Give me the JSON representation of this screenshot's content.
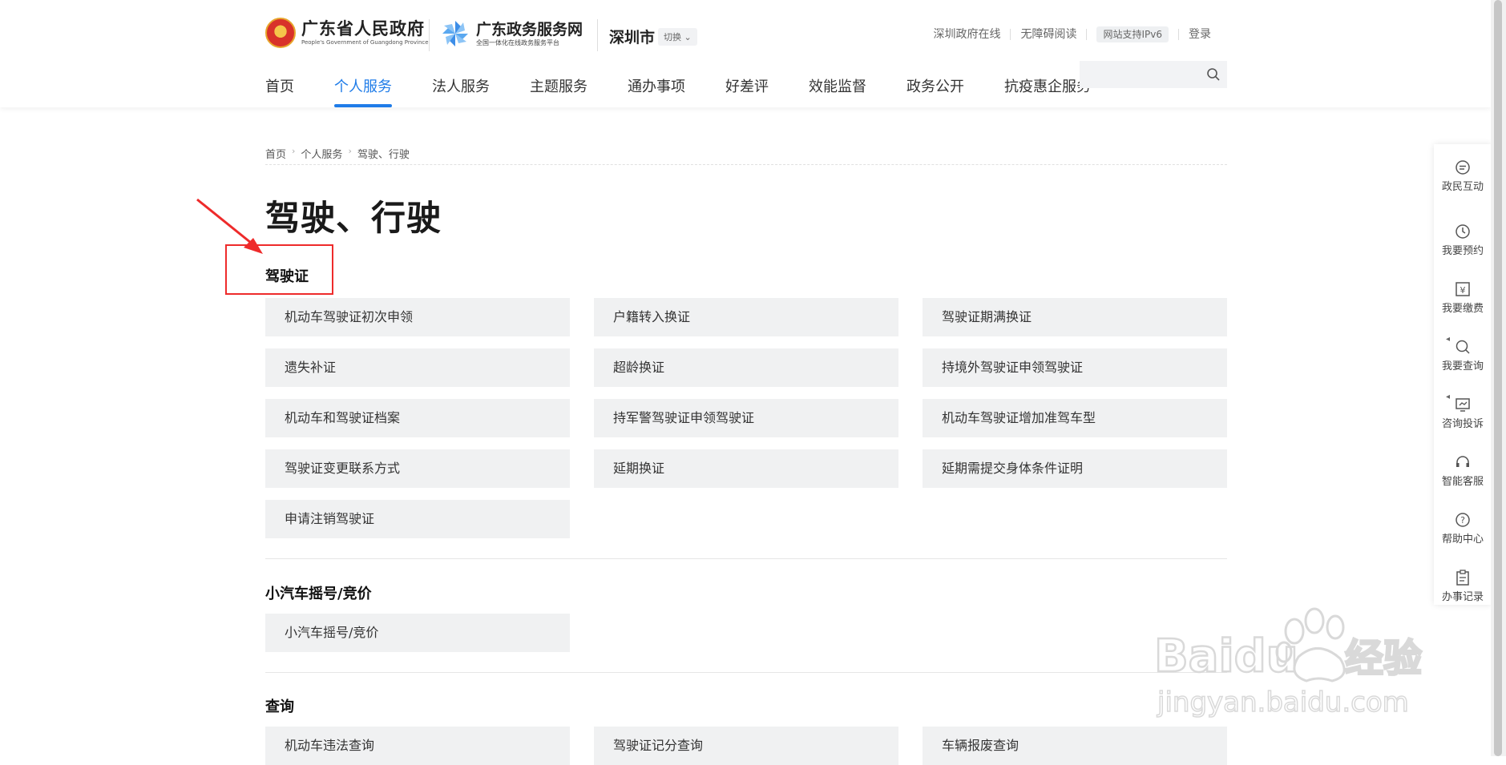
{
  "header": {
    "gov_title": "广东省人民政府",
    "gov_subtitle": "People's Government of Guangdong Province",
    "service_title": "广东政务服务网",
    "service_subtitle": "全国一体化在线政务服务平台",
    "city": "深圳市",
    "switch_label": "切换",
    "top_links": [
      "深圳政府在线",
      "无障碍阅读",
      "网站支持IPv6",
      "登录"
    ],
    "nav": [
      "首页",
      "个人服务",
      "法人服务",
      "主题服务",
      "通办事项",
      "好差评",
      "效能监督",
      "政务公开",
      "抗疫惠企服务"
    ],
    "active_nav": "个人服务",
    "search_placeholder": ""
  },
  "breadcrumb": [
    "首页",
    "个人服务",
    "驾驶、行驶"
  ],
  "page_title": "驾驶、行驶",
  "sections": [
    {
      "title": "驾驶证",
      "items": [
        "机动车驾驶证初次申领",
        "户籍转入换证",
        "驾驶证期满换证",
        "遗失补证",
        "超龄换证",
        "持境外驾驶证申领驾驶证",
        "机动车和驾驶证档案",
        "持军警驾驶证申领驾驶证",
        "机动车驾驶证增加准驾车型",
        "驾驶证变更联系方式",
        "延期换证",
        "延期需提交身体条件证明",
        "申请注销驾驶证"
      ]
    },
    {
      "title": "小汽车摇号/竞价",
      "items": [
        "小汽车摇号/竞价"
      ]
    },
    {
      "title": "查询",
      "items": [
        "机动车违法查询",
        "驾驶证记分查询",
        "车辆报废查询"
      ]
    }
  ],
  "sidebar": [
    "政民互动",
    "我要预约",
    "我要缴费",
    "我要查询",
    "咨询投诉",
    "智能客服",
    "帮助中心",
    "办事记录"
  ],
  "watermark": {
    "brand": "Baidu",
    "cn": "经验",
    "url": "jingyan.baidu.com"
  },
  "colors": {
    "accent": "#1f7ce8",
    "annotation": "#ee2b2b",
    "item_bg": "#f0f1f2"
  }
}
